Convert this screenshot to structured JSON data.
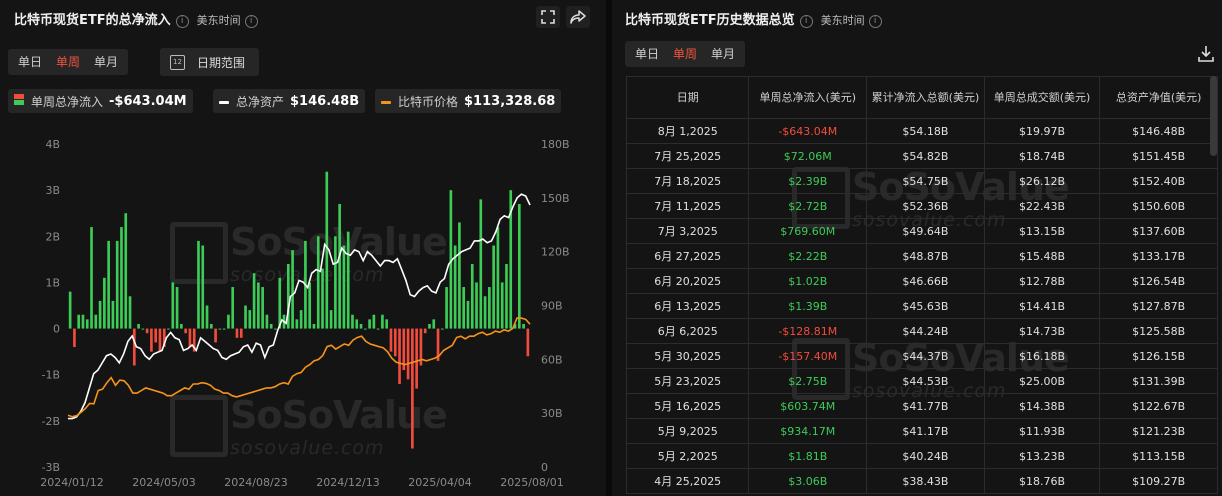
{
  "left": {
    "title": "比特币现货ETF的总净流入",
    "timezone": "美东时间",
    "period_tabs": [
      "单日",
      "单周",
      "单月"
    ],
    "active_tab": "单周",
    "date_range_label": "日期范围",
    "legend": [
      {
        "label": "单周总净流入",
        "value": "-$643.04M",
        "color": "#f24c3d",
        "color2": "#3dcc57"
      },
      {
        "label": "总净资产",
        "value": "$146.48B",
        "color": "#ffffff"
      },
      {
        "label": "比特币价格",
        "value": "$113,328.68",
        "color": "#f7931a"
      }
    ],
    "icons": [
      "fullscreen-icon",
      "share-icon",
      "calendar-icon",
      "info-icon"
    ]
  },
  "right": {
    "title": "比特币现货ETF历史数据总览",
    "timezone": "美东时间",
    "period_tabs": [
      "单日",
      "单周",
      "单月"
    ],
    "active_tab": "单周",
    "columns": [
      "日期",
      "单周总净流入(美元)",
      "累计净流入总额(美元)",
      "单周总成交额(美元)",
      "总资产净值(美元)"
    ],
    "rows": [
      [
        "8月 1,2025",
        "-$643.04M",
        "$54.18B",
        "$19.97B",
        "$146.48B"
      ],
      [
        "7月 25,2025",
        "$72.06M",
        "$54.82B",
        "$18.74B",
        "$151.45B"
      ],
      [
        "7月 18,2025",
        "$2.39B",
        "$54.75B",
        "$26.12B",
        "$152.40B"
      ],
      [
        "7月 11,2025",
        "$2.72B",
        "$52.36B",
        "$22.43B",
        "$150.60B"
      ],
      [
        "7月 3,2025",
        "$769.60M",
        "$49.64B",
        "$13.15B",
        "$137.60B"
      ],
      [
        "6月 27,2025",
        "$2.22B",
        "$48.87B",
        "$15.48B",
        "$133.17B"
      ],
      [
        "6月 20,2025",
        "$1.02B",
        "$46.66B",
        "$12.78B",
        "$126.54B"
      ],
      [
        "6月 13,2025",
        "$1.39B",
        "$45.63B",
        "$14.41B",
        "$127.87B"
      ],
      [
        "6月 6,2025",
        "-$128.81M",
        "$44.24B",
        "$14.73B",
        "$125.58B"
      ],
      [
        "5月 30,2025",
        "-$157.40M",
        "$44.37B",
        "$16.18B",
        "$126.15B"
      ],
      [
        "5月 23,2025",
        "$2.75B",
        "$44.53B",
        "$25.00B",
        "$131.39B"
      ],
      [
        "5月 16,2025",
        "$603.74M",
        "$41.77B",
        "$14.38B",
        "$122.67B"
      ],
      [
        "5月 9,2025",
        "$934.17M",
        "$41.17B",
        "$11.93B",
        "$121.23B"
      ],
      [
        "5月 2,2025",
        "$1.81B",
        "$40.24B",
        "$13.23B",
        "$113.15B"
      ],
      [
        "4月 25,2025",
        "$3.06B",
        "$38.43B",
        "$18.76B",
        "$109.27B"
      ]
    ],
    "icons": [
      "download-icon",
      "info-icon"
    ]
  },
  "watermark": {
    "brand": "SoSoValue",
    "site": "sosovalue.com"
  },
  "chart_data": {
    "type": "bar",
    "x_tick_labels": [
      "2024/01/12",
      "2024/05/03",
      "2024/08/23",
      "2024/12/13",
      "2025/04/04",
      "2025/08/01"
    ],
    "y_left_ticks": [
      "4B",
      "3B",
      "2B",
      "1B",
      "0",
      "-1B",
      "-2B",
      "-3B"
    ],
    "y_left_range": [
      -3,
      4
    ],
    "y_right_ticks": [
      "180B",
      "150B",
      "120B",
      "90B",
      "60B",
      "30B",
      "0"
    ],
    "y_right_range": [
      0,
      180
    ],
    "series": [
      {
        "name": "单周总净流入",
        "type": "bar",
        "unit": "B",
        "values": [
          0.8,
          -0.4,
          0.3,
          0.3,
          0.2,
          2.2,
          0.3,
          0.6,
          1.1,
          1.9,
          0.6,
          1.9,
          2.2,
          2.5,
          0.7,
          -0.8,
          0.1,
          0.0,
          -0.1,
          -0.5,
          -0.3,
          -0.5,
          -0.4,
          0.0,
          1.0,
          0.9,
          0.1,
          -0.1,
          -0.4,
          -0.5,
          1.9,
          1.8,
          0.5,
          0.1,
          -0.3,
          0.0,
          0.0,
          0.3,
          0.9,
          -0.2,
          -0.2,
          0.5,
          0.4,
          1.2,
          1.0,
          0.9,
          0.3,
          0.1,
          0.0,
          1.1,
          0.3,
          1.4,
          1.7,
          0.2,
          0.4,
          1.9,
          1.0,
          0.1,
          2.0,
          1.3,
          3.4,
          0.4,
          2.0,
          2.7,
          1.8,
          2.1,
          0.3,
          0.2,
          0.1,
          0.0,
          0.2,
          0.3,
          0.0,
          0.3,
          0.2,
          -0.5,
          -0.6,
          -1.2,
          -0.9,
          -1.1,
          -2.6,
          -1.3,
          -0.8,
          -0.1,
          0.1,
          0.2,
          -0.7,
          0.0,
          0.9,
          3.0,
          1.8,
          2.3,
          0.9,
          0.6,
          1.4,
          1.0,
          2.8,
          0.7,
          0.9,
          1.8,
          2.2,
          1.0,
          1.4,
          3.0,
          0.1,
          2.7,
          0.1,
          -0.6
        ],
        "positive_color": "#3dcc57",
        "negative_color": "#f24c3d"
      },
      {
        "name": "总净资产",
        "type": "line",
        "unit": "B",
        "color": "#ffffff",
        "values": [
          27,
          27,
          28,
          31,
          36,
          44,
          52,
          54,
          58,
          62,
          63,
          61,
          58,
          63,
          70,
          73,
          67,
          66,
          62,
          60,
          63,
          64,
          65,
          72,
          75,
          72,
          71,
          65,
          66,
          68,
          65,
          72,
          70,
          68,
          66,
          65,
          61,
          60,
          62,
          63,
          64,
          67,
          68,
          64,
          69,
          68,
          61,
          67,
          68,
          76,
          82,
          80,
          95,
          97,
          104,
          103,
          100,
          108,
          110,
          109,
          124,
          121,
          113,
          114,
          122,
          119,
          118,
          121,
          120,
          115,
          120,
          118,
          115,
          112,
          115,
          115,
          114,
          116,
          110,
          104,
          96,
          95,
          98,
          100,
          101,
          98,
          97,
          103,
          105,
          113,
          116,
          118,
          120,
          121,
          122,
          126,
          126,
          127,
          125,
          126,
          131,
          138,
          140,
          139,
          145,
          150,
          152,
          151,
          146
        ]
      },
      {
        "name": "比特币价格",
        "type": "line",
        "unit": "K",
        "color": "#f7931a",
        "values": [
          42.8,
          41.7,
          42.5,
          45,
          48,
          52,
          51.7,
          62,
          63,
          68,
          72,
          66,
          70,
          69.5,
          66,
          60,
          60,
          62,
          64,
          63,
          62,
          61,
          60,
          58,
          58,
          60,
          62,
          64,
          63,
          67,
          67,
          68,
          67.5,
          66,
          63,
          62,
          60,
          60,
          58,
          57,
          58,
          59,
          60,
          61,
          62,
          63,
          64,
          64,
          65,
          67,
          68,
          67,
          73,
          75,
          76,
          80,
          82,
          85,
          86,
          89,
          96,
          97,
          94,
          96,
          98,
          97,
          101,
          103,
          104,
          100,
          98,
          97,
          96,
          95,
          92,
          87,
          84,
          83,
          82,
          83,
          84,
          85,
          86,
          85,
          86,
          87,
          89,
          93,
          95,
          97,
          103,
          104,
          102,
          104,
          104,
          106,
          107,
          105,
          106,
          108,
          107,
          109,
          108,
          110,
          118,
          118,
          117,
          113.3
        ]
      }
    ]
  }
}
